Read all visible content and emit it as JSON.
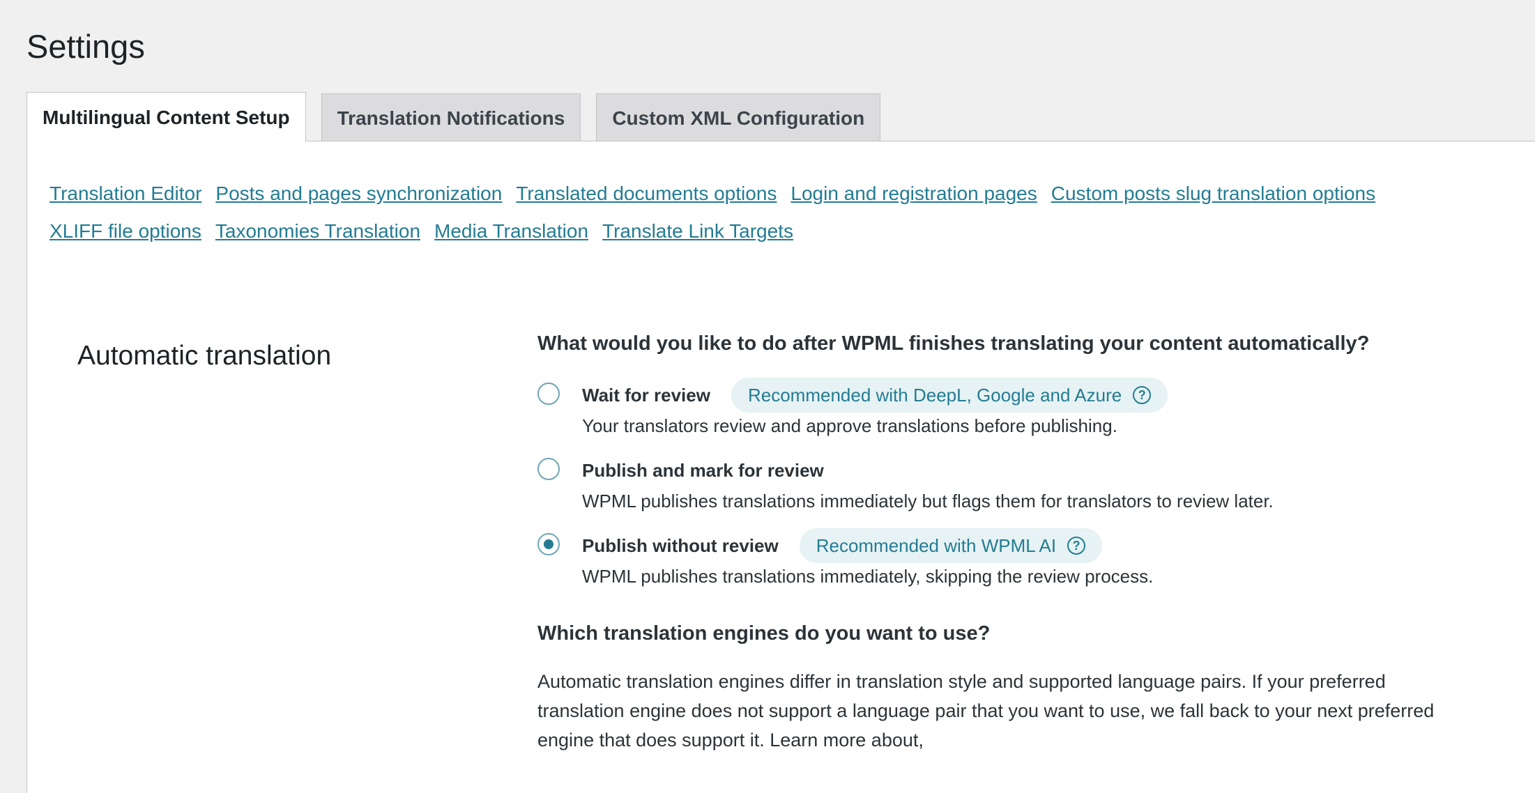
{
  "page": {
    "title": "Settings"
  },
  "tabs": [
    {
      "label": "Multilingual Content Setup",
      "active": true
    },
    {
      "label": "Translation Notifications",
      "active": false
    },
    {
      "label": "Custom XML Configuration",
      "active": false
    }
  ],
  "subnav": {
    "links": [
      "Translation Editor",
      "Posts and pages synchronization",
      "Translated documents options",
      "Login and registration pages",
      "Custom posts slug translation options",
      "XLIFF file options",
      "Taxonomies Translation",
      "Media Translation",
      "Translate Link Targets"
    ]
  },
  "section": {
    "title": "Automatic translation"
  },
  "review": {
    "question": "What would you like to do after WPML finishes translating your content automatically?",
    "options": [
      {
        "label": "Wait for review",
        "badge": "Recommended with DeepL, Google and Azure",
        "description": "Your translators review and approve translations before publishing.",
        "checked": false
      },
      {
        "label": "Publish and mark for review",
        "badge": "",
        "description": "WPML publishes translations immediately but flags them for translators to review later.",
        "checked": false
      },
      {
        "label": "Publish without review",
        "badge": "Recommended with WPML AI",
        "description": "WPML publishes translations immediately, skipping the review process.",
        "checked": true
      }
    ],
    "help_glyph": "?"
  },
  "engines": {
    "title": "Which translation engines do you want to use?",
    "description": "Automatic translation engines differ in translation style and supported language pairs. If your preferred translation engine does not support a language pair that you want to use, we fall back to your next preferred engine that does support it. Learn more about,"
  },
  "colors": {
    "background": "#f0f0f1",
    "panel": "#ffffff",
    "link": "#237c92",
    "badge_bg": "#e6f2f4",
    "radio_border": "#6fa5b5",
    "text": "#2c3338"
  },
  "icons": {
    "help": "question-circle-icon",
    "radio": "radio-button"
  }
}
